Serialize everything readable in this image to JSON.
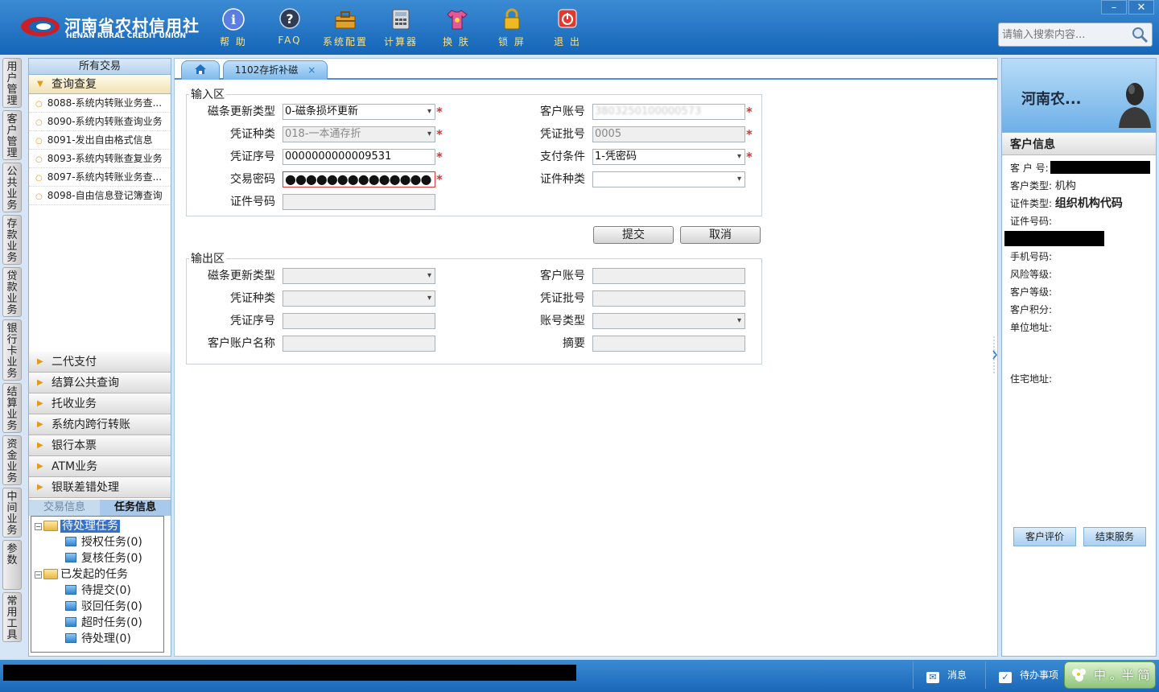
{
  "app": {
    "logo_cn": "河南省农村信用社",
    "logo_en": "HENAN RURAL CREDIT UNION"
  },
  "toolbar": {
    "help": "帮 助",
    "faq": "FAQ",
    "settings": "系统配置",
    "calculator": "计算器",
    "skin": "换 肤",
    "lock": "锁 屏",
    "exit": "退 出"
  },
  "window_controls": {
    "minimize": "–",
    "close": "✕"
  },
  "search": {
    "placeholder": "请输入搜索内容..."
  },
  "vtabs": [
    "用户管理",
    "客户管理",
    "公共业务",
    "存款业务",
    "贷款业务",
    "银行卡业务",
    "结算业务",
    "资金业务",
    "中间业务",
    "参数",
    "常用工具"
  ],
  "leftnav": {
    "title": "所有交易",
    "open_group": "查询查复",
    "items": [
      "8088-系统内转账业务查...",
      "8090-系统内转账查询业务",
      "8091-发出自由格式信息",
      "8093-系统内转账查复业务",
      "8097-系统内转账业务查...",
      "8098-自由信息登记簿查询"
    ],
    "groups": [
      "二代支付",
      "结算公共查询",
      "托收业务",
      "系统内跨行转账",
      "银行本票",
      "ATM业务",
      "银联差错处理"
    ]
  },
  "taskpanel": {
    "tab_trade": "交易信息",
    "tab_task": "任务信息",
    "pending": "待处理任务",
    "authorize": "授权任务(0)",
    "review": "复核任务(0)",
    "initiated": "已发起的任务",
    "to_submit": "待提交(0)",
    "rejected": "驳回任务(0)",
    "timeout": "超时任务(0)",
    "to_handle": "待处理(0)"
  },
  "tabs": {
    "active": "1102存折补磁",
    "close": "×"
  },
  "input_area": {
    "legend": "输入区",
    "fields": {
      "stripe_type": {
        "label": "磁条更新类型",
        "value": "0-磁条损坏更新"
      },
      "account": {
        "label": "客户账号",
        "value": "3803250100000573"
      },
      "voucher_type": {
        "label": "凭证种类",
        "value": "018-一本通存折"
      },
      "voucher_batch": {
        "label": "凭证批号",
        "value": "0005"
      },
      "voucher_no": {
        "label": "凭证序号",
        "value": "0000000000009531"
      },
      "pay_cond": {
        "label": "支付条件",
        "value": "1-凭密码"
      },
      "password": {
        "label": "交易密码",
        "value": "●●●●●●●●●●●●●●"
      },
      "id_type": {
        "label": "证件种类",
        "value": ""
      },
      "id_no": {
        "label": "证件号码",
        "value": ""
      }
    },
    "required_mark": "*"
  },
  "buttons": {
    "submit": "提交",
    "cancel": "取消"
  },
  "output_area": {
    "legend": "输出区",
    "fields": {
      "stripe_type": "磁条更新类型",
      "account": "客户账号",
      "voucher_type": "凭证种类",
      "voucher_batch": "凭证批号",
      "voucher_no": "凭证序号",
      "acct_type": "账号类型",
      "acct_name": "客户账户名称",
      "summary": "摘要"
    }
  },
  "customer": {
    "name": "河南农...",
    "section_title": "客户信息",
    "customer_no_label": "客 户 号:",
    "customer_type_label": "客户类型:",
    "customer_type_value": "机构",
    "id_type_label": "证件类型:",
    "id_type_value": "组织机构代码",
    "id_no_label": "证件号码:",
    "phone_label": "手机号码:",
    "risk_label": "风险等级:",
    "level_label": "客户等级:",
    "points_label": "客户积分:",
    "work_addr_label": "单位地址:",
    "home_addr_label": "住宅地址:",
    "evaluate_btn": "客户评价",
    "end_btn": "结束服务"
  },
  "statusbar": {
    "messages": "消息",
    "todo": "待办事项",
    "ime": "中 。半 简"
  },
  "colors": {
    "header_blue": "#1565b9",
    "tab_label_gold": "#ffe27a",
    "required_red": "#e03030"
  }
}
